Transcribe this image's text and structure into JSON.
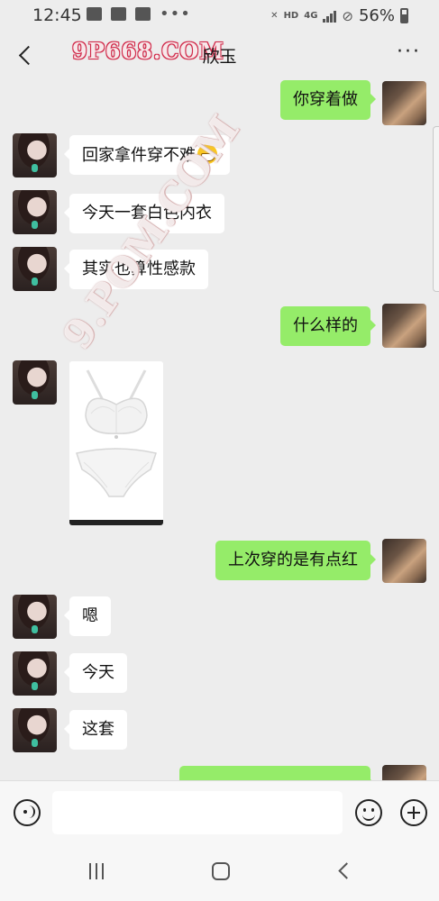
{
  "status_bar": {
    "time": "12:45",
    "network": "HD",
    "network_type": "4G",
    "battery": "56%"
  },
  "header": {
    "title": "欣玉",
    "watermark": "9P668.COM"
  },
  "watermark_diagonal": "9.POM.COM",
  "messages": [
    {
      "side": "right",
      "text": "你穿着做"
    },
    {
      "side": "left",
      "text": "回家拿件穿不难"
    },
    {
      "side": "left",
      "text": "今天一套白色内衣"
    },
    {
      "side": "left",
      "text": "其实也算性感款"
    },
    {
      "side": "right",
      "text": "什么样的"
    },
    {
      "side": "left",
      "type": "image",
      "image_name": "white-lingerie-photo"
    },
    {
      "side": "right",
      "text": "上次穿的是有点红"
    },
    {
      "side": "left",
      "text": "嗯"
    },
    {
      "side": "left",
      "text": "今天"
    },
    {
      "side": "left",
      "text": "这套"
    }
  ],
  "input": {
    "value": "",
    "placeholder": ""
  },
  "icons": {
    "back": "chevron-left-icon",
    "more": "more-dots-icon",
    "voice": "voice-icon",
    "emoji": "emoji-icon",
    "plus": "plus-icon"
  },
  "colors": {
    "background": "#ededed",
    "bubble_right": "#95ec69",
    "bubble_left": "#ffffff"
  }
}
